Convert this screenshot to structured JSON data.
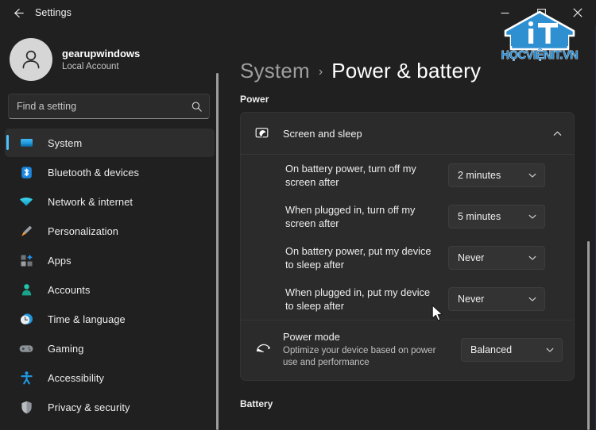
{
  "titlebar": {
    "back_label": "back-arrow",
    "title": "Settings",
    "minimize": "minimize",
    "maximize": "maximize",
    "close": "close"
  },
  "profile": {
    "name": "gearupwindows",
    "account_type": "Local Account",
    "avatar_icon": "person-icon"
  },
  "search": {
    "placeholder": "Find a setting",
    "value": "",
    "icon": "search-icon"
  },
  "sidebar": {
    "items": [
      {
        "label": "System",
        "icon": "monitor-icon",
        "selected": true
      },
      {
        "label": "Bluetooth & devices",
        "icon": "bluetooth-icon",
        "selected": false
      },
      {
        "label": "Network & internet",
        "icon": "wifi-icon",
        "selected": false
      },
      {
        "label": "Personalization",
        "icon": "paintbrush-icon",
        "selected": false
      },
      {
        "label": "Apps",
        "icon": "apps-icon",
        "selected": false
      },
      {
        "label": "Accounts",
        "icon": "account-icon",
        "selected": false
      },
      {
        "label": "Time & language",
        "icon": "clock-icon",
        "selected": false
      },
      {
        "label": "Gaming",
        "icon": "gamepad-icon",
        "selected": false
      },
      {
        "label": "Accessibility",
        "icon": "accessibility-icon",
        "selected": false
      },
      {
        "label": "Privacy & security",
        "icon": "shield-icon",
        "selected": false
      }
    ]
  },
  "breadcrumb": {
    "parent": "System",
    "separator": "›",
    "current": "Power & battery"
  },
  "main": {
    "power_section_heading": "Power",
    "battery_section_heading": "Battery",
    "screen_and_sleep": {
      "title": "Screen and sleep",
      "icon": "screen-sleep-icon",
      "expanded": true,
      "chevron": "chevron-up-icon",
      "rows": [
        {
          "label": "On battery power, turn off my screen after",
          "value": "2 minutes"
        },
        {
          "label": "When plugged in, turn off my screen after",
          "value": "5 minutes"
        },
        {
          "label": "On battery power, put my device to sleep after",
          "value": "Never"
        },
        {
          "label": "When plugged in, put my device to sleep after",
          "value": "Never"
        }
      ]
    },
    "power_mode": {
      "title": "Power mode",
      "description": "Optimize your device based on power use and performance",
      "icon": "gauge-icon",
      "value": "Balanced"
    }
  },
  "watermark": {
    "logo_letters": "iT",
    "text": "HỌCVIỆNIT.VN"
  },
  "colors": {
    "accent": "#4cc2ff",
    "window_bg": "#202020",
    "card_bg": "#2b2b2b",
    "combo_bg": "#333333",
    "watermark_blue": "#2b8fd4"
  }
}
